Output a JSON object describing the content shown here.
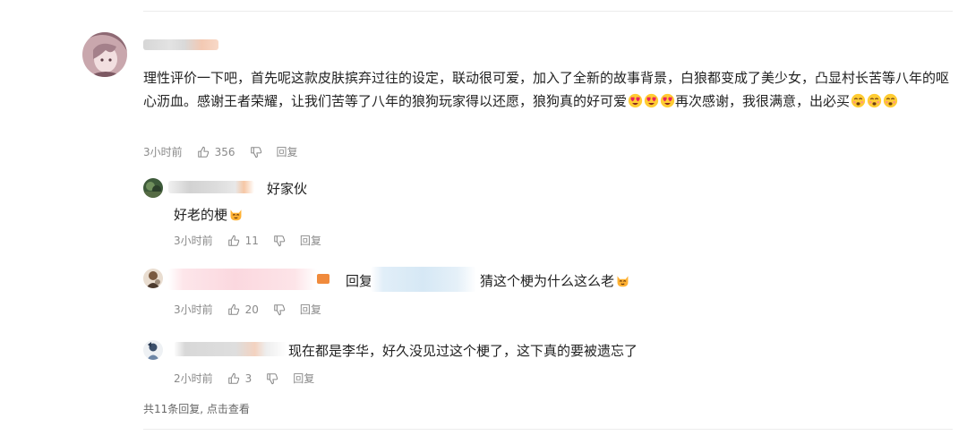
{
  "main_comment": {
    "text_part1": "理性评价一下吧，首先呢这款皮肤摈弃过往的设定，联动很可爱，加入了全新的故事背景，白狼都变成了美少女，凸显村长苦等八年的呕心沥血。感谢王者荣耀，让我们苦等了八年的狼狗玩家得以还愿，狼狗真的好可爱",
    "text_part2": "再次感谢，我很满意，出必买",
    "time": "3小时前",
    "likes": "356",
    "reply_label": "回复"
  },
  "replies": [
    {
      "inline_text": "好家伙",
      "body_text": "好老的梗",
      "time": "3小时前",
      "likes": "11",
      "reply_label": "回复"
    },
    {
      "prefix": "回复",
      "inline_text": "猜这个梗为什么这么老",
      "time": "3小时前",
      "likes": "20",
      "reply_label": "回复"
    },
    {
      "inline_text": "现在都是李华，好久没见过这个梗了，这下真的要被遗忘了",
      "time": "2小时前",
      "likes": "3",
      "reply_label": "回复"
    }
  ],
  "footer": {
    "view_replies": "共11条回复, 点击查看"
  },
  "icons": {
    "like": "thumbs-up-icon",
    "dislike": "thumbs-down-icon",
    "emoji_heart_eyes": "heart-eyes-emoji-icon",
    "emoji_smile": "smiling-emoji-icon",
    "emoji_cat": "cat-emoji-icon"
  }
}
